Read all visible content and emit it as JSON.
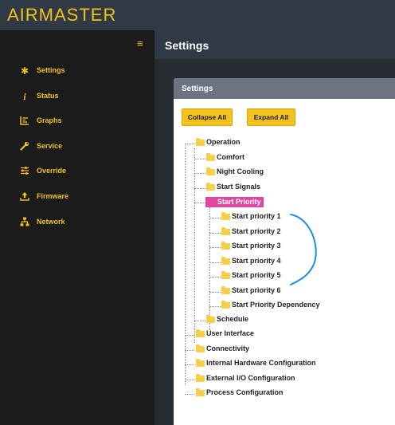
{
  "app": {
    "brand": "AIRMASTER",
    "menu_icon": "hamburger-icon",
    "accent": "#f2c21a",
    "highlight": "#e047a0"
  },
  "sidebar": {
    "items": [
      {
        "label": "Settings",
        "icon": "gear-icon"
      },
      {
        "label": "Status",
        "icon": "info-icon"
      },
      {
        "label": "Graphs",
        "icon": "chart-icon"
      },
      {
        "label": "Service",
        "icon": "wrench-icon"
      },
      {
        "label": "Override",
        "icon": "sliders-icon"
      },
      {
        "label": "Firmware",
        "icon": "upload-icon"
      },
      {
        "label": "Network",
        "icon": "network-icon"
      }
    ]
  },
  "main": {
    "title": "Settings"
  },
  "panel": {
    "title": "Settings",
    "collapse_label": "Collapse All",
    "expand_label": "Expand All"
  },
  "tree": {
    "operation": "Operation",
    "comfort": "Comfort",
    "night_cooling": "Night Cooling",
    "start_signals": "Start Signals",
    "start_priority": "Start Priority",
    "sp1": "Start priority 1",
    "sp2": "Start priority 2",
    "sp3": "Start priority 3",
    "sp4": "Start priority 4",
    "sp5": "Start priority 5",
    "sp6": "Start priority 6",
    "spd": "Start Priority Dependency",
    "schedule": "Schedule",
    "user_interface": "User Interface",
    "connectivity": "Connectivity",
    "ihc": "Internal Hardware Configuration",
    "eio": "External I/O Configuration",
    "process": "Process Configuration"
  }
}
